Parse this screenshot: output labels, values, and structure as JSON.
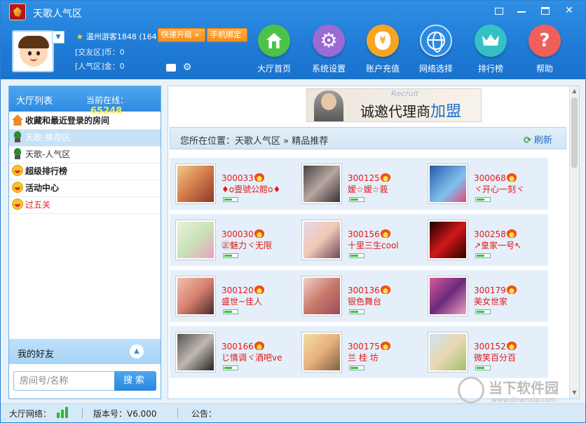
{
  "window": {
    "title": "天歌人气区"
  },
  "user": {
    "name": "温州游客1848 (164",
    "upgrade_btn": "快速升级",
    "upgrade_arrow": "»",
    "phone_btn": "手机绑定",
    "line1": "[交友区]币：0",
    "line2": "[人气区]金：0"
  },
  "nav": [
    {
      "label": "大厅首页",
      "icon": "home-icon"
    },
    {
      "label": "系统设置",
      "icon": "gear-icon"
    },
    {
      "label": "账户充值",
      "icon": "money-bag-icon"
    },
    {
      "label": "网络选择",
      "icon": "globe-icon"
    },
    {
      "label": "排行榜",
      "icon": "crown-icon"
    },
    {
      "label": "帮助",
      "icon": "question-icon"
    }
  ],
  "left": {
    "title": "大厅列表",
    "online_label": "当前在线：",
    "online_count": "65248",
    "items": [
      {
        "label": "收藏和最近登录的房间",
        "icon": "house-icon",
        "style": "bold"
      },
      {
        "label": "天歌-推荐区",
        "icon": "mic-icon",
        "style": "sel"
      },
      {
        "label": "天歌-人气区",
        "icon": "mic-icon",
        "style": "grey"
      },
      {
        "label": "超级排行榜",
        "icon": "smile-icon",
        "style": "bold"
      },
      {
        "label": "活动中心",
        "icon": "smile-icon",
        "style": "bold"
      },
      {
        "label": "过五关",
        "icon": "smile-icon",
        "style": "red"
      }
    ],
    "friends": "我的好友",
    "search_placeholder": "房间号/名称",
    "search_btn": "搜索"
  },
  "main": {
    "banner": {
      "text": "诚邀代理商",
      "highlight": "加盟",
      "recruit": "Recruit"
    },
    "crumb": "您所在位置：天歌人气区 » 精品推荐",
    "refresh": "刷新",
    "rooms": [
      {
        "id": "300033",
        "name": "♦o壹號公館o♦",
        "pic": "linear-gradient(135deg,#f4c98a,#d07a4a 50%,#8a3a2a)",
        "level": 0.6
      },
      {
        "id": "300125",
        "name": "嫒☆嫒☆莪",
        "pic": "linear-gradient(135deg,#444,#b9a6a0 50%,#333)",
        "level": 0.6
      },
      {
        "id": "300068",
        "name": "ヾ开心一刻ヾ",
        "pic": "linear-gradient(135deg,#2a5aa8,#7fc1f0 60%,#e04a7a)",
        "level": 0.6
      },
      {
        "id": "300030",
        "name": "㊣魅力ヾ无限",
        "pic": "linear-gradient(135deg,#e8f0da,#c9e3b5 50%,#e8a0c8)",
        "level": 0.6
      },
      {
        "id": "300156",
        "name": "十里三生cool",
        "pic": "linear-gradient(135deg,#e6d8e8,#f0c8b4 50%,#6a4a5a)",
        "level": 0.6
      },
      {
        "id": "300258",
        "name": "↗皇家一号↖",
        "pic": "linear-gradient(135deg,#1a0000,#d01818 50%,#300000)",
        "level": 0.6
      },
      {
        "id": "300120",
        "name": "盛世~佳人",
        "pic": "linear-gradient(135deg,#f0c0b0,#d88070 50%,#4a2a2a)",
        "level": 0.6
      },
      {
        "id": "300136",
        "name": "银色舞台",
        "pic": "linear-gradient(135deg,#f0d0c8,#c87a6a 50%,#a04a5a)",
        "level": 0.6
      },
      {
        "id": "300179",
        "name": "美女世家",
        "pic": "linear-gradient(135deg,#d85a9a,#6a2a7a 50%,#f0a0c0)",
        "level": 0.6
      },
      {
        "id": "300166",
        "name": "じ情调ヾ酒吧ve",
        "pic": "linear-gradient(135deg,#555,#c0b8b0 50%,#222)",
        "level": 0.6
      },
      {
        "id": "300175",
        "name": "兰 桂 坊",
        "pic": "linear-gradient(135deg,#f0e0a0,#e8b080 50%,#806040)",
        "level": 0.6
      },
      {
        "id": "300152",
        "name": "微笑百分百",
        "pic": "linear-gradient(135deg,#cce4f4,#e8d8b0 50%,#a0c070)",
        "level": 0.6
      }
    ]
  },
  "status": {
    "net_label": "大厅网络：",
    "version": "版本号：V6.000",
    "notice": "公告："
  },
  "watermark": {
    "title": "当下软件园",
    "url": "www.downxia.com"
  }
}
